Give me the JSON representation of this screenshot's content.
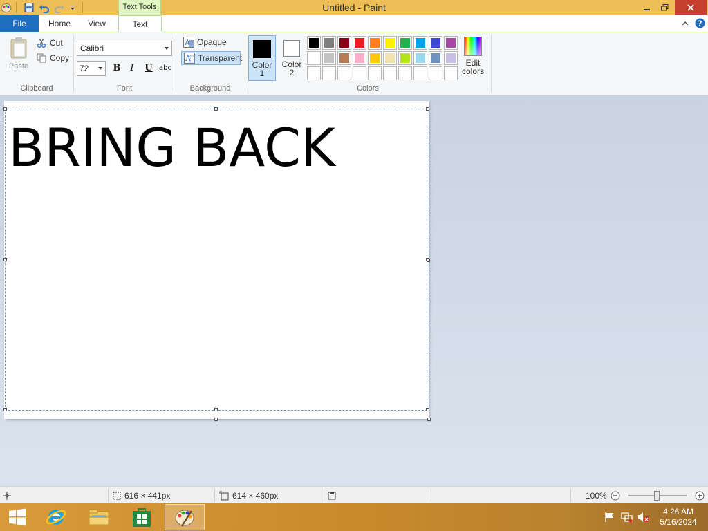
{
  "window": {
    "title": "Untitled - Paint",
    "context_tab": "Text Tools"
  },
  "tabs": {
    "file": "File",
    "home": "Home",
    "view": "View",
    "text": "Text"
  },
  "ribbon": {
    "clipboard": {
      "group": "Clipboard",
      "paste": "Paste",
      "cut": "Cut",
      "copy": "Copy"
    },
    "font": {
      "group": "Font",
      "family": "Calibri",
      "size": "72",
      "bold": "B",
      "italic": "I",
      "underline": "U",
      "strike": "abc"
    },
    "background": {
      "group": "Background",
      "opaque": "Opaque",
      "transparent": "Transparent"
    },
    "colors": {
      "group": "Colors",
      "color1_label": "Color",
      "color1_num": "1",
      "color2_label": "Color",
      "color2_num": "2",
      "color1_value": "#000000",
      "color2_value": "#ffffff",
      "edit_label": "Edit",
      "edit_label2": "colors",
      "palette_row1": [
        "#000000",
        "#7f7f7f",
        "#880015",
        "#ed1c24",
        "#ff7f27",
        "#fff200",
        "#22b14c",
        "#00a2e8",
        "#3f48cc",
        "#a349a4"
      ],
      "palette_row2": [
        "#ffffff",
        "#c3c3c3",
        "#b97a57",
        "#ffaec9",
        "#ffc90e",
        "#efe4b0",
        "#b5e61d",
        "#99d9ea",
        "#7092be",
        "#c8bfe7"
      ],
      "palette_row3": [
        "",
        "",
        "",
        "",
        "",
        "",
        "",
        "",
        "",
        ""
      ]
    }
  },
  "canvas": {
    "text": "BRING BACK"
  },
  "statusbar": {
    "selection_size": "616 × 441px",
    "canvas_size": "614 × 460px",
    "zoom": "100%"
  },
  "taskbar": {
    "time": "4:26 AM",
    "date": "5/16/2024"
  }
}
